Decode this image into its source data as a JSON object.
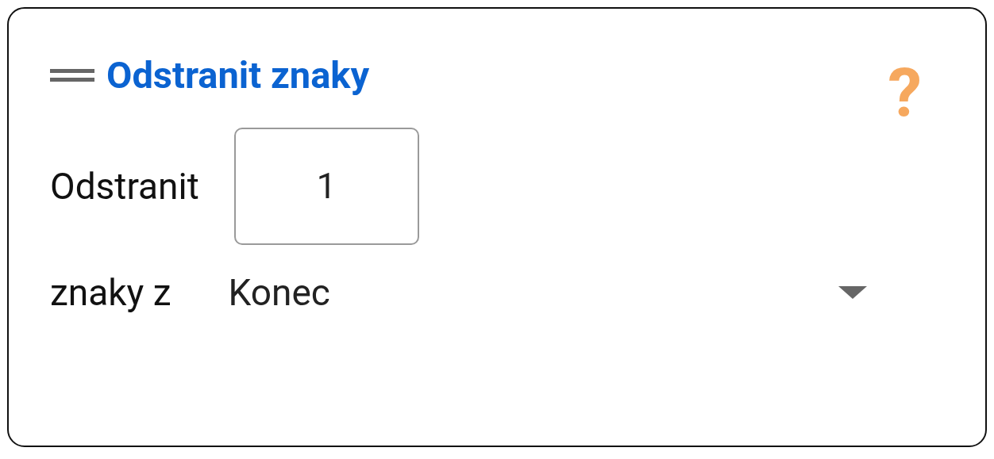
{
  "card": {
    "title": "Odstranit znaky",
    "help": "?"
  },
  "rows": [
    {
      "kind": "number",
      "label": "Odstranit",
      "value": "1"
    },
    {
      "kind": "dropdown",
      "label": "znaky z",
      "value": "Konec"
    }
  ]
}
